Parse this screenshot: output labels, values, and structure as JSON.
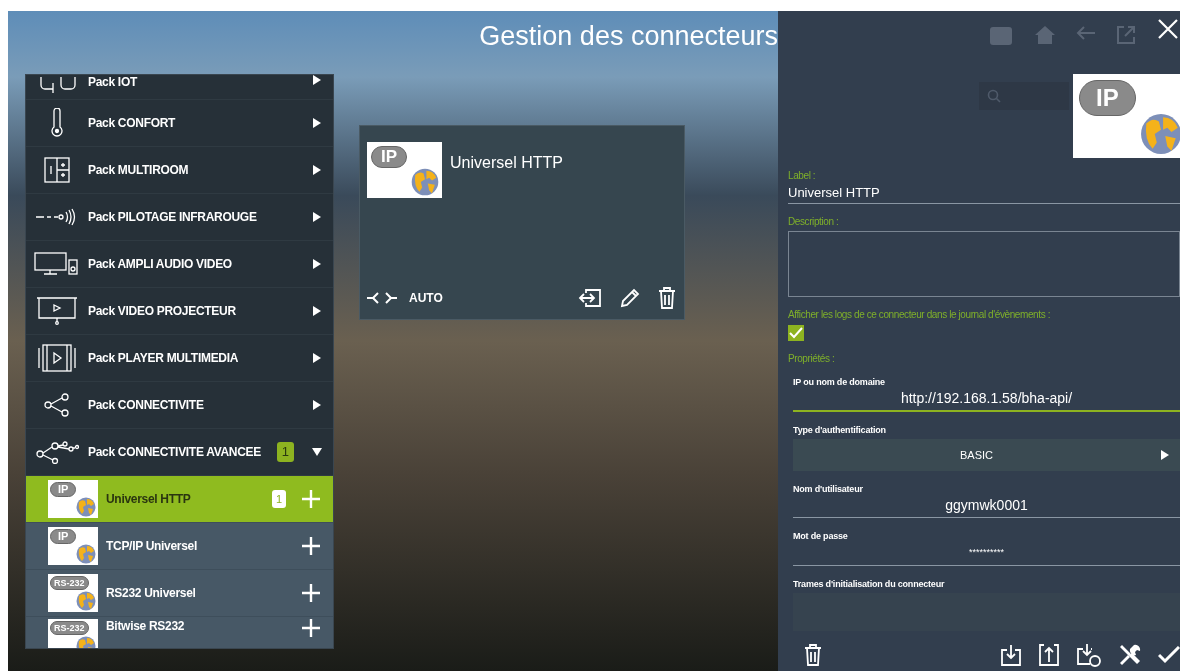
{
  "title": "Gestion des connecteurs",
  "packs": [
    {
      "label": "Pack IOT",
      "expanded": false
    },
    {
      "label": "Pack CONFORT",
      "expanded": false
    },
    {
      "label": "Pack MULTIROOM",
      "expanded": false
    },
    {
      "label": "Pack PILOTAGE INFRAROUGE",
      "expanded": false
    },
    {
      "label": "Pack AMPLI AUDIO VIDEO",
      "expanded": false
    },
    {
      "label": "Pack VIDEO PROJECTEUR",
      "expanded": false
    },
    {
      "label": "Pack PLAYER MULTIMEDIA",
      "expanded": false
    },
    {
      "label": "Pack CONNECTIVITE",
      "expanded": false
    },
    {
      "label": "Pack CONNECTIVITE AVANCEE",
      "expanded": true,
      "badge": "1",
      "children": [
        {
          "label": "Universel HTTP",
          "logo_text": "IP",
          "selected": true,
          "count": "1"
        },
        {
          "label": "TCP/IP Universel",
          "logo_text": "IP",
          "selected": false
        },
        {
          "label": "RS232 Universel",
          "logo_text": "RS-232",
          "selected": false
        },
        {
          "label": "Bitwise RS232",
          "logo_text": "RS-232",
          "selected": false
        }
      ]
    }
  ],
  "card": {
    "logo_text": "IP",
    "name": "Universel HTTP",
    "mode": "AUTO"
  },
  "panel": {
    "logo_text": "IP",
    "label_caption": "Label :",
    "label_value": "Universel HTTP",
    "description_caption": "Description :",
    "logs_caption": "Afficher les logs de ce connecteur dans le journal d'évènements :",
    "logs_checked": true,
    "properties_caption": "Propriétés :",
    "properties": [
      {
        "kind": "text",
        "label": "IP ou nom de domaine",
        "value": "http://192.168.1.58/bha-api/",
        "focused": true
      },
      {
        "kind": "select",
        "label": "Type d'authentification",
        "value": "BASIC"
      },
      {
        "kind": "text",
        "label": "Nom d'utilisateur",
        "value": "ggymwk0001",
        "focused": false
      },
      {
        "kind": "password",
        "label": "Mot de passe",
        "value": "**********",
        "focused": false
      },
      {
        "kind": "textarea",
        "label": "Trames d'initialisation du connecteur"
      }
    ]
  }
}
